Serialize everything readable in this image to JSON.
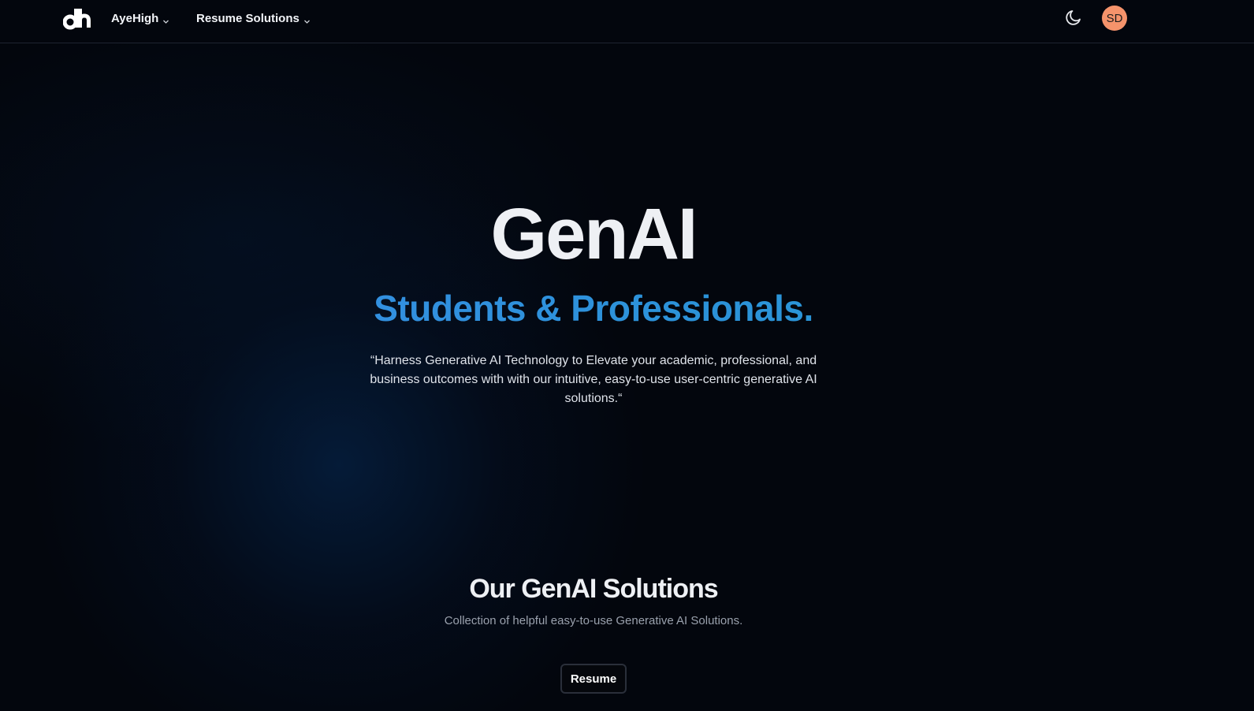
{
  "header": {
    "logo_icon": "dh-logo-icon",
    "nav": [
      {
        "label": "AyeHigh",
        "icon": "chevron-down-icon"
      },
      {
        "label": "Resume Solutions",
        "icon": "chevron-down-icon"
      }
    ],
    "theme_toggle_icon": "moon-icon",
    "avatar_initials": "SD",
    "avatar_color": "#f5936b"
  },
  "hero": {
    "title": "GenAI",
    "subtitle": "Students & Professionals.",
    "subtitle_color": "#2e8fe0",
    "quote": "“Harness Generative AI Technology to Elevate your academic, professional, and business outcomes with with our intuitive, easy-to-use user-centric generative AI solutions.“"
  },
  "solutions": {
    "title": "Our GenAI Solutions",
    "subtitle": "Collection of helpful easy-to-use Generative AI Solutions.",
    "tabs": [
      {
        "label": "Resume",
        "active": true
      }
    ]
  },
  "colors": {
    "background": "#03060d",
    "accent": "#2e8fe0"
  }
}
